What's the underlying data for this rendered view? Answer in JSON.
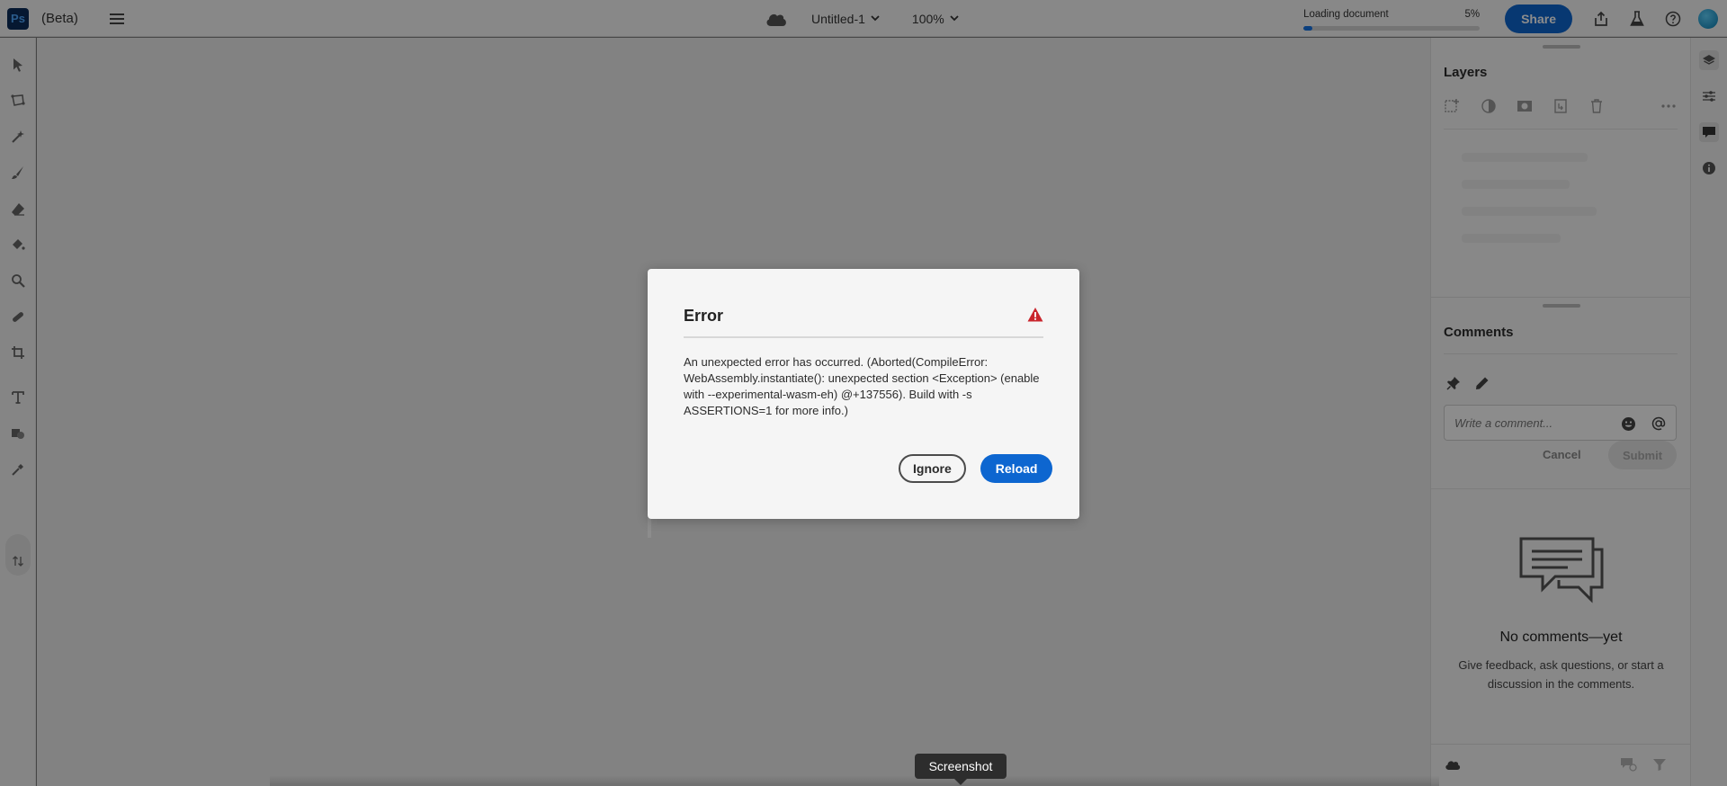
{
  "app": {
    "logo_text": "Ps",
    "beta_label": "(Beta)"
  },
  "header": {
    "document_name": "Untitled-1",
    "zoom": "100%",
    "loading_label": "Loading document",
    "loading_percent": "5%",
    "loading_progress_fraction": 0.05,
    "share_label": "Share"
  },
  "tools": [
    "select-tool-icon",
    "lasso-tool-icon",
    "quick-select-icon",
    "brush-icon",
    "eraser-icon",
    "paint-bucket-icon",
    "clone-stamp-icon",
    "healing-brush-icon",
    "crop-icon",
    "type-tool-icon",
    "shape-tool-icon",
    "eyedropper-icon",
    "swap-colors-icon"
  ],
  "layers_panel": {
    "title": "Layers"
  },
  "comments_panel": {
    "title": "Comments",
    "input_placeholder": "Write a comment...",
    "cancel_label": "Cancel",
    "submit_label": "Submit",
    "empty_title": "No comments—yet",
    "empty_description": "Give feedback, ask questions, or start a discussion in the comments."
  },
  "dialog": {
    "title": "Error",
    "message": "An unexpected error has occurred. (Aborted(CompileError: WebAssembly.instantiate(): unexpected section <Exception> (enable with --experimental-wasm-eh) @+137556). Build with -s ASSERTIONS=1 for more info.)",
    "ignore_label": "Ignore",
    "reload_label": "Reload"
  },
  "tooltip": {
    "label": "Screenshot"
  },
  "colors": {
    "accent": "#0d66d0",
    "warning": "#c9252d",
    "overlay": "rgba(0,0,0,0.45)"
  }
}
